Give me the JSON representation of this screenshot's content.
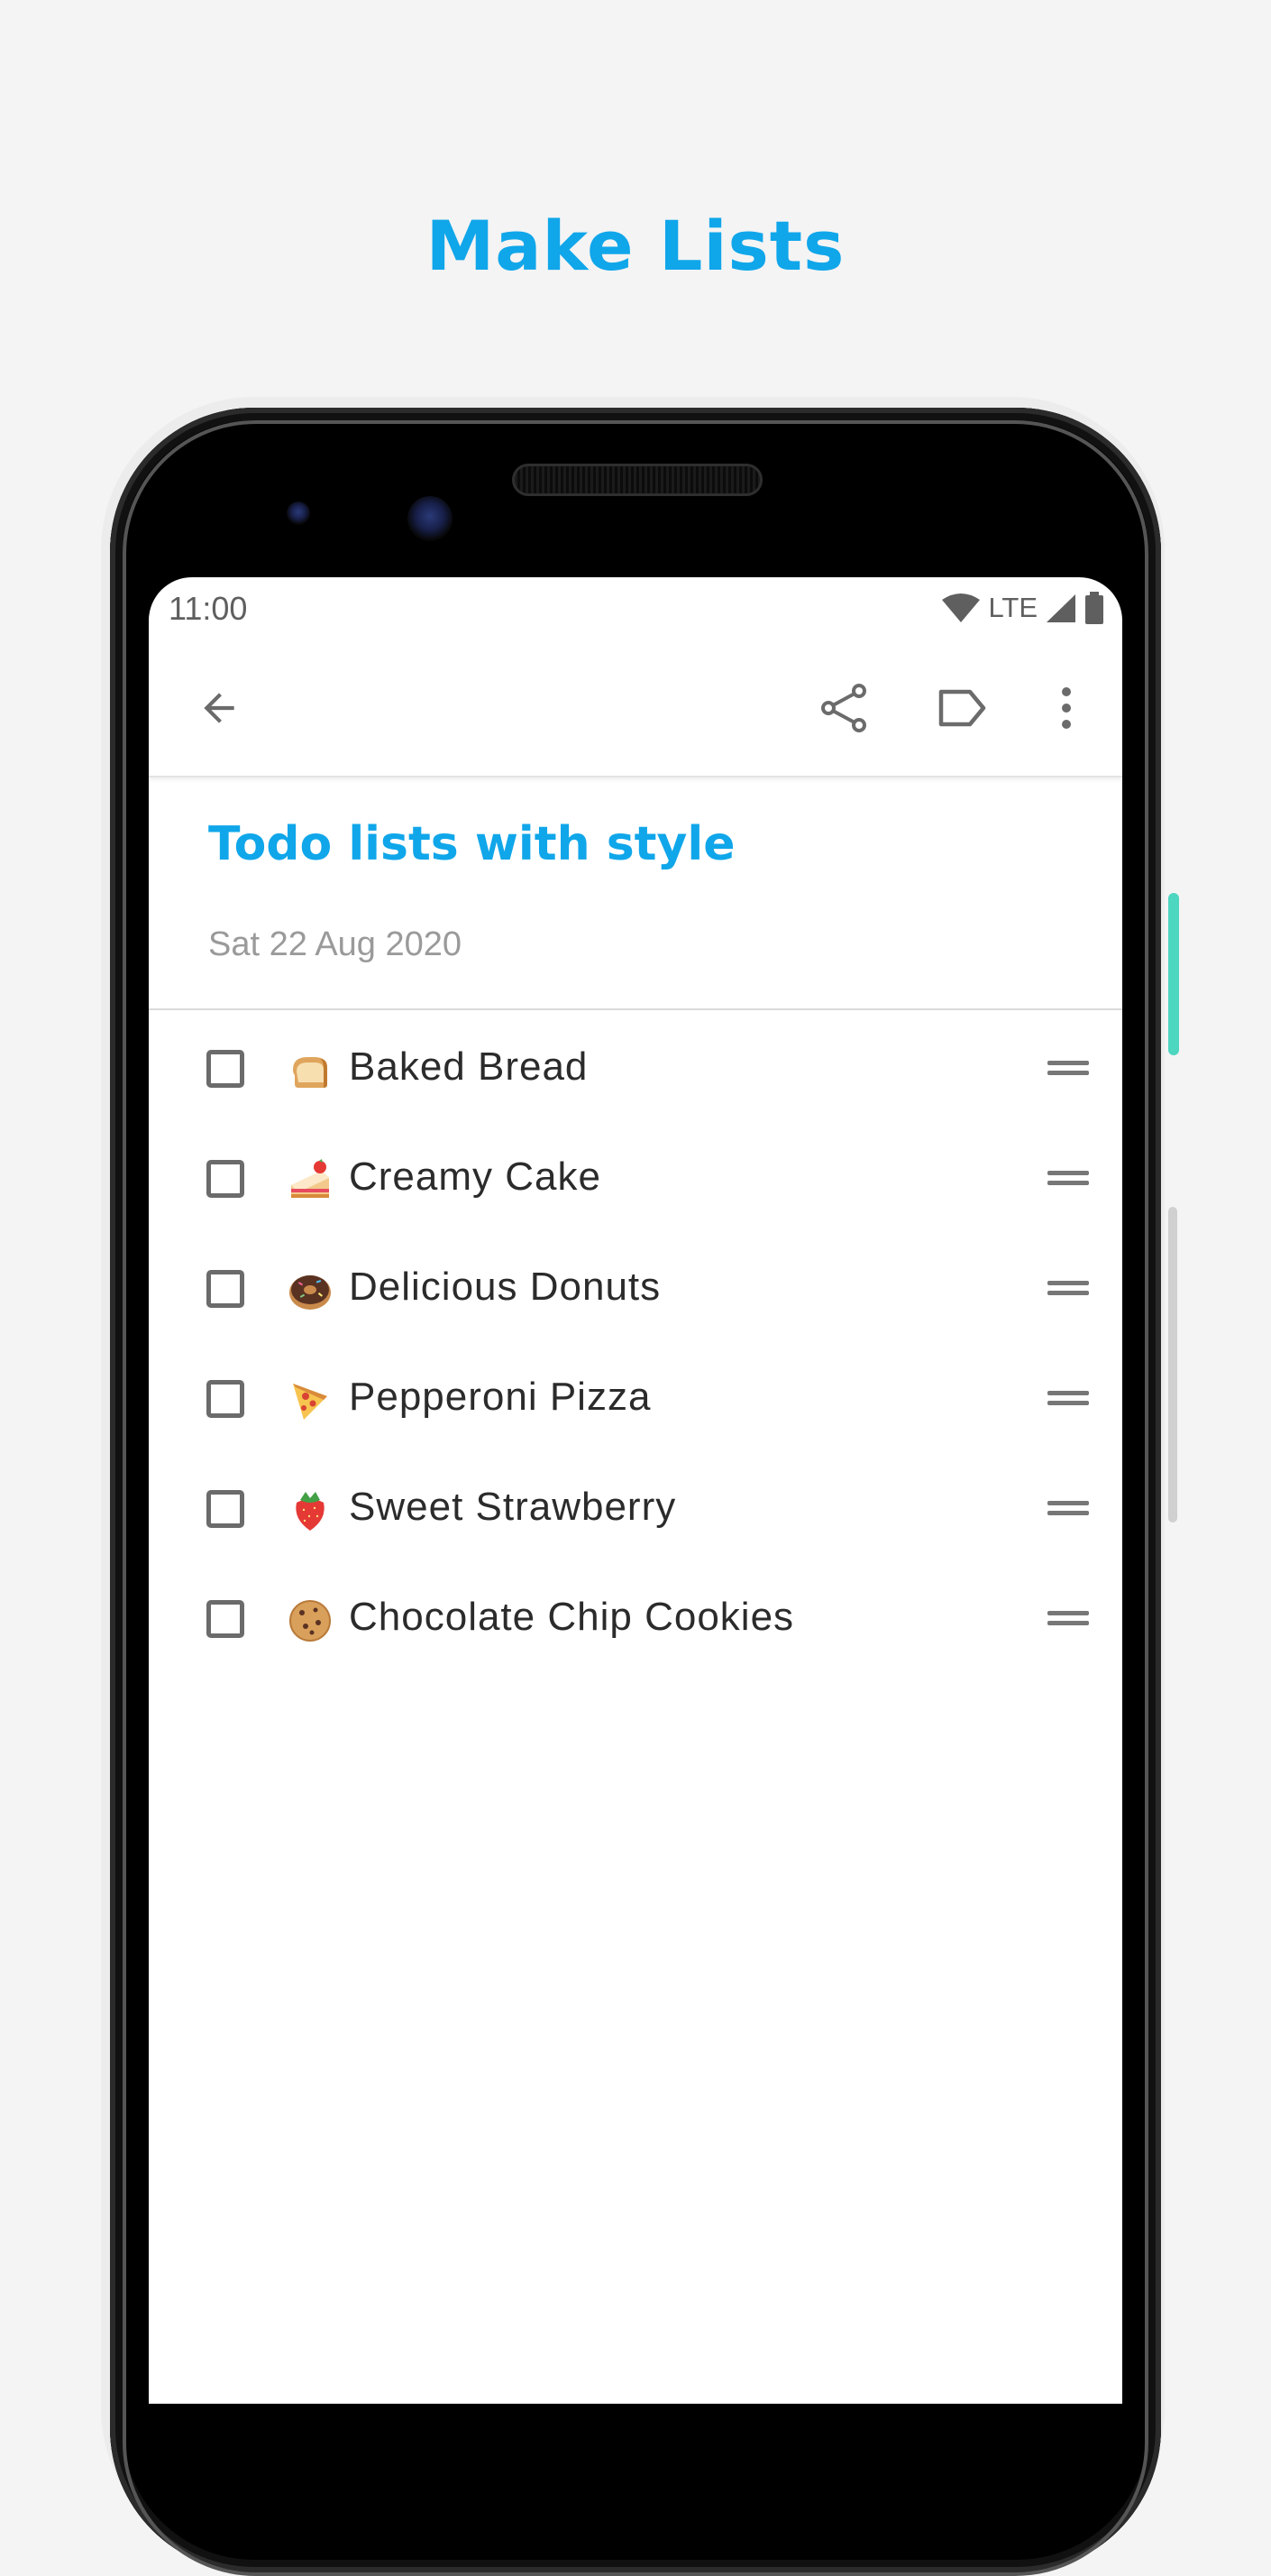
{
  "headline": "Make Lists",
  "status": {
    "time": "11:00",
    "network": "LTE"
  },
  "toolbar": {
    "back_icon": "arrow-left-icon",
    "share_icon": "share-icon",
    "label_icon": "label-icon",
    "more_icon": "more-vert-icon"
  },
  "note": {
    "title": "Todo lists with style",
    "date": "Sat 22 Aug 2020"
  },
  "items": [
    {
      "emoji": "bread-icon",
      "text": "Baked Bread",
      "checked": false
    },
    {
      "emoji": "cake-icon",
      "text": "Creamy Cake",
      "checked": false
    },
    {
      "emoji": "donut-icon",
      "text": "Delicious Donuts",
      "checked": false
    },
    {
      "emoji": "pizza-icon",
      "text": "Pepperoni Pizza",
      "checked": false
    },
    {
      "emoji": "strawberry-icon",
      "text": "Sweet Strawberry",
      "checked": false
    },
    {
      "emoji": "cookie-icon",
      "text": "Chocolate Chip Cookies",
      "checked": false
    }
  ],
  "colors": {
    "accent": "#10a6ea",
    "background": "#f4f4f4"
  }
}
